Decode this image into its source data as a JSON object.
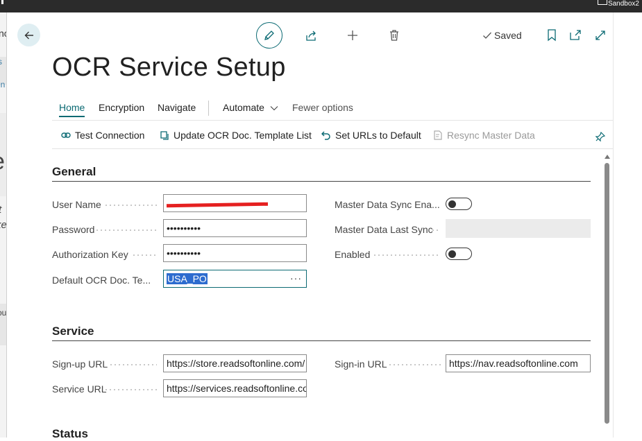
{
  "topbar": {
    "sandbox_label": "Sandbox2"
  },
  "background_fragments": [
    "nc",
    "s",
    "en",
    "e",
    "t",
    "ke",
    "ou"
  ],
  "header": {
    "saved_label": "Saved",
    "title": "OCR Service Setup"
  },
  "tabs": [
    "Home",
    "Encryption",
    "Navigate",
    "Automate",
    "Fewer options"
  ],
  "actions": {
    "test_connection": "Test Connection",
    "update_template": "Update OCR Doc. Template List",
    "set_urls": "Set URLs to Default",
    "resync": "Resync Master Data"
  },
  "general": {
    "heading": "General",
    "user_name_label": "User Name",
    "password_label": "Password",
    "password_value": "••••••••••",
    "auth_key_label": "Authorization Key",
    "auth_key_value": "••••••••••",
    "default_template_label": "Default OCR Doc. Te...",
    "default_template_value": "USA_PO",
    "ellipsis": "···",
    "master_sync_enabled_label": "Master Data Sync Ena...",
    "master_sync_enabled": false,
    "master_last_sync_label": "Master Data Last Sync",
    "master_last_sync_value": "",
    "enabled_label": "Enabled",
    "enabled": false
  },
  "service": {
    "heading": "Service",
    "signup_label": "Sign-up URL",
    "signup_value": "https://store.readsoftonline.com/",
    "signin_label": "Sign-in URL",
    "signin_value": "https://nav.readsoftonline.com",
    "service_url_label": "Service URL",
    "service_url_value": "https://services.readsoftonline.co"
  },
  "status": {
    "heading": "Status"
  },
  "colors": {
    "accent": "#0b6a73",
    "selection": "#2d6ccf",
    "topbar": "#2b2b2b"
  }
}
